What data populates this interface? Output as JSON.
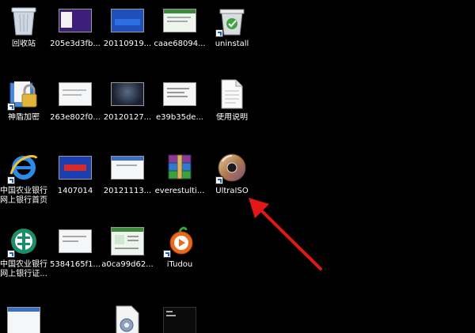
{
  "desktop": {
    "icons": [
      {
        "label": "回收站",
        "icon": "recycle-bin-icon"
      },
      {
        "label": "205e3d3fb...",
        "icon": "image-thumbnail-icon"
      },
      {
        "label": "20110919...",
        "icon": "image-thumbnail-icon"
      },
      {
        "label": "caae68094...",
        "icon": "image-thumbnail-icon"
      },
      {
        "label": "uninstall",
        "icon": "uninstall-icon"
      },
      {
        "label": "神盾加密",
        "icon": "lock-folder-icon"
      },
      {
        "label": "263e802f0...",
        "icon": "image-thumbnail-icon"
      },
      {
        "label": "20120127...",
        "icon": "image-thumbnail-icon"
      },
      {
        "label": "e39b35de...",
        "icon": "image-thumbnail-icon"
      },
      {
        "label": "使用说明",
        "icon": "text-document-icon"
      },
      {
        "label": "中国农业银行网上银行首页",
        "icon": "internet-explorer-icon"
      },
      {
        "label": "1407014",
        "icon": "image-thumbnail-icon"
      },
      {
        "label": "20121113...",
        "icon": "image-thumbnail-icon"
      },
      {
        "label": "everestulti...",
        "icon": "winrar-archive-icon"
      },
      {
        "label": "UltraISO",
        "icon": "ultraiso-disc-icon"
      },
      {
        "label": "中国农业银行网上银行证...",
        "icon": "abc-bank-icon"
      },
      {
        "label": "5384165f1...",
        "icon": "image-thumbnail-icon"
      },
      {
        "label": "a0ca99d62...",
        "icon": "image-thumbnail-icon"
      },
      {
        "label": "iTudou",
        "icon": "itudou-icon"
      }
    ]
  },
  "annotation": {
    "arrow_color": "#e01818"
  }
}
